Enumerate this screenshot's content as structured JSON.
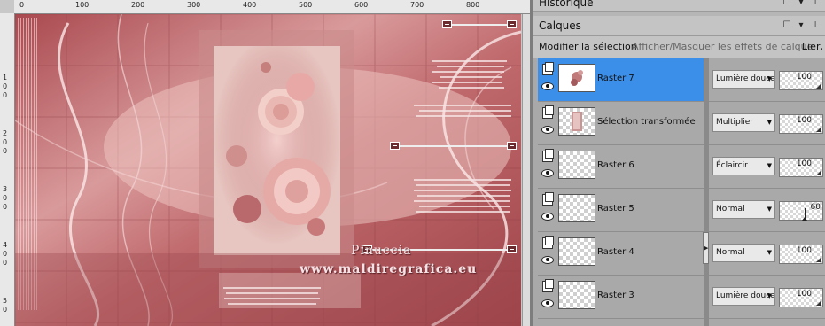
{
  "canvas": {
    "ruler_top_labels": [
      "0",
      "100",
      "200",
      "300",
      "400",
      "500",
      "600",
      "700",
      "800"
    ],
    "ruler_left_labels": [
      "1",
      "0",
      "0",
      "2",
      "0",
      "0",
      "3",
      "0",
      "0",
      "4",
      "0",
      "0",
      "5",
      "0"
    ],
    "watermark_name": "Pinuccia",
    "watermark_url": "www.maldiregrafica.eu"
  },
  "panels": {
    "historique_title": "Historique",
    "calques_title": "Calques",
    "toolbar": {
      "modify_selection": "Modifier la sélection",
      "show_hide_effects": "Afficher/Masquer les effets de calque",
      "link": "Lier,"
    },
    "layers": [
      {
        "name": "Raster 7",
        "blend": "Lumière douce",
        "opacity": "100",
        "selected": true
      },
      {
        "name": "Sélection transformée",
        "blend": "Multiplier",
        "opacity": "100",
        "selected": false
      },
      {
        "name": "Raster 6",
        "blend": "Éclaircir",
        "opacity": "100",
        "selected": false
      },
      {
        "name": "Raster 5",
        "blend": "Normal",
        "opacity": "60",
        "selected": false
      },
      {
        "name": "Raster 4",
        "blend": "Normal",
        "opacity": "100",
        "selected": false
      },
      {
        "name": "Raster 3",
        "blend": "Lumière douce",
        "opacity": "100",
        "selected": false
      }
    ]
  },
  "colors": {
    "selected_layer": "#3b8fe8",
    "image_base": "#b65a5d",
    "handle": "#6b2a2e"
  },
  "icons": [
    "layer-icon",
    "eye-icon",
    "dropdown-chevron-icon",
    "minimize-icon",
    "pin-icon",
    "collapse-arrow-icon"
  ]
}
